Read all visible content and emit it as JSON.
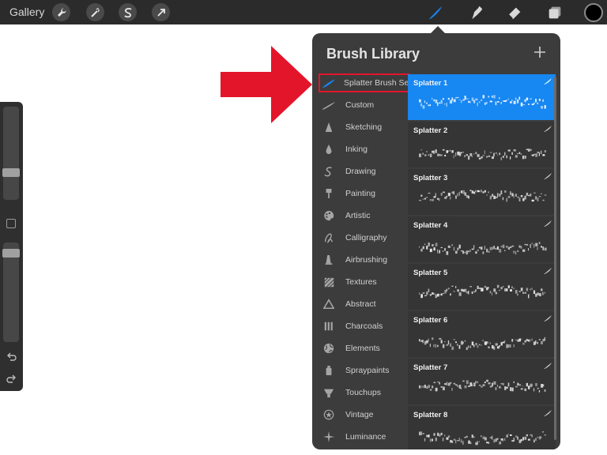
{
  "toolbar": {
    "gallery_label": "Gallery",
    "actions": [
      {
        "name": "actions",
        "icon": "wrench-icon"
      },
      {
        "name": "adjustments",
        "icon": "magic-wand-icon"
      },
      {
        "name": "selection",
        "icon": "selection-s-icon"
      },
      {
        "name": "transform",
        "icon": "transform-arrow-icon"
      }
    ],
    "tools": [
      {
        "name": "brush",
        "icon": "brush-icon",
        "active": true
      },
      {
        "name": "smudge",
        "icon": "smudge-icon"
      },
      {
        "name": "eraser",
        "icon": "eraser-icon"
      },
      {
        "name": "layers",
        "icon": "layers-icon"
      }
    ],
    "active_color": "#000000",
    "accent_color": "#1787f2"
  },
  "sidebar": {
    "size_slider_value": 0.3,
    "opacity_slider_value": 0.9
  },
  "brush_library": {
    "title": "Brush Library",
    "add_icon": "plus-icon",
    "categories": [
      {
        "label": "Splatter Brush Set",
        "icon": "splatter-icon",
        "selected": true
      },
      {
        "label": "Custom",
        "icon": "custom-stroke-icon"
      },
      {
        "label": "Sketching",
        "icon": "pencil-icon"
      },
      {
        "label": "Inking",
        "icon": "ink-drop-icon"
      },
      {
        "label": "Drawing",
        "icon": "drawing-swirl-icon"
      },
      {
        "label": "Painting",
        "icon": "paint-brush-icon"
      },
      {
        "label": "Artistic",
        "icon": "palette-icon"
      },
      {
        "label": "Calligraphy",
        "icon": "calligraphy-icon"
      },
      {
        "label": "Airbrushing",
        "icon": "airbrush-icon"
      },
      {
        "label": "Textures",
        "icon": "texture-icon"
      },
      {
        "label": "Abstract",
        "icon": "triangle-icon"
      },
      {
        "label": "Charcoals",
        "icon": "charcoal-icon"
      },
      {
        "label": "Elements",
        "icon": "globe-icon"
      },
      {
        "label": "Spraypaints",
        "icon": "spray-can-icon"
      },
      {
        "label": "Touchups",
        "icon": "touchup-icon"
      },
      {
        "label": "Vintage",
        "icon": "star-badge-icon"
      },
      {
        "label": "Luminance",
        "icon": "sparkle-icon"
      }
    ],
    "brushes": [
      {
        "name": "Splatter 1",
        "selected": true
      },
      {
        "name": "Splatter 2"
      },
      {
        "name": "Splatter 3"
      },
      {
        "name": "Splatter 4"
      },
      {
        "name": "Splatter 5"
      },
      {
        "name": "Splatter 6"
      },
      {
        "name": "Splatter 7"
      },
      {
        "name": "Splatter 8"
      }
    ]
  },
  "annotation": {
    "arrow_color": "#e3152b",
    "highlight_color": "#e3152b"
  }
}
